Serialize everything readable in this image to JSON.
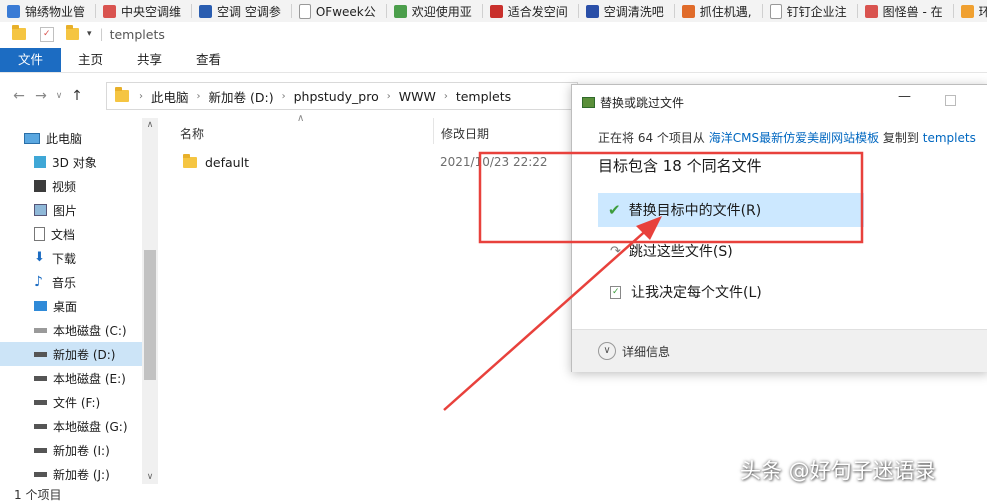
{
  "bookmarks": [
    {
      "label": "锦绣物业管",
      "color": "#3a7bd5"
    },
    {
      "label": "中央空调维",
      "color": "#d9534f"
    },
    {
      "label": "空调 空调参",
      "color": "#2a5db0"
    },
    {
      "label": "OFweek公",
      "color": "#999999"
    },
    {
      "label": "欢迎使用亚",
      "color": "#4b9e4b"
    },
    {
      "label": "适合发空间",
      "color": "#c9302c"
    },
    {
      "label": "空调清洗吧",
      "color": "#2a4fa8"
    },
    {
      "label": "抓住机遇,",
      "color": "#e06b2a"
    },
    {
      "label": "钉钉企业注",
      "color": "#8a8a8a"
    },
    {
      "label": "图怪兽 - 在",
      "color": "#d9534f"
    },
    {
      "label": "环保",
      "color": "#f0a030"
    }
  ],
  "window": {
    "title": "templets"
  },
  "ribbon": {
    "tabs": [
      "文件",
      "主页",
      "共享",
      "查看"
    ]
  },
  "address": {
    "crumbs": [
      "此电脑",
      "新加卷 (D:)",
      "phpstudy_pro",
      "WWW",
      "templets"
    ]
  },
  "nav": {
    "items": [
      {
        "label": "此电脑",
        "icon": "computer-icon"
      },
      {
        "label": "3D 对象",
        "icon": "cube-icon"
      },
      {
        "label": "视频",
        "icon": "video-icon"
      },
      {
        "label": "图片",
        "icon": "picture-icon"
      },
      {
        "label": "文档",
        "icon": "document-icon"
      },
      {
        "label": "下载",
        "icon": "download-icon"
      },
      {
        "label": "音乐",
        "icon": "music-icon"
      },
      {
        "label": "桌面",
        "icon": "desktop-icon"
      },
      {
        "label": "本地磁盘 (C:)",
        "icon": "drive-icon"
      },
      {
        "label": "新加卷 (D:)",
        "icon": "drive-icon"
      },
      {
        "label": "本地磁盘 (E:)",
        "icon": "drive-icon"
      },
      {
        "label": "文件 (F:)",
        "icon": "drive-icon"
      },
      {
        "label": "本地磁盘 (G:)",
        "icon": "drive-icon"
      },
      {
        "label": "新加卷 (I:)",
        "icon": "drive-icon"
      },
      {
        "label": "新加卷 (J:)",
        "icon": "drive-icon"
      }
    ],
    "selected": "新加卷 (D:)"
  },
  "list": {
    "col_name": "名称",
    "col_date": "修改日期",
    "rows": [
      {
        "name": "default",
        "date": "2021/10/23 22:22"
      }
    ]
  },
  "status": "1 个项目",
  "dialog": {
    "title": "替换或跳过文件",
    "line_pre": "正在将 64 个项目从",
    "source": "海洋CMS最新仿爱美剧网站模板",
    "line_mid": "复制到",
    "dest": "templets",
    "heading": "目标包含 18 个同名文件",
    "options": [
      "替换目标中的文件(R)",
      "跳过这些文件(S)",
      "让我决定每个文件(L)"
    ],
    "details": "详细信息"
  },
  "watermark": "头条 @好句子迷语录",
  "colors": {
    "accent": "#1c6cc2",
    "highlight": "#cce8ff",
    "annotation": "#e8413c",
    "link": "#0067c0"
  }
}
